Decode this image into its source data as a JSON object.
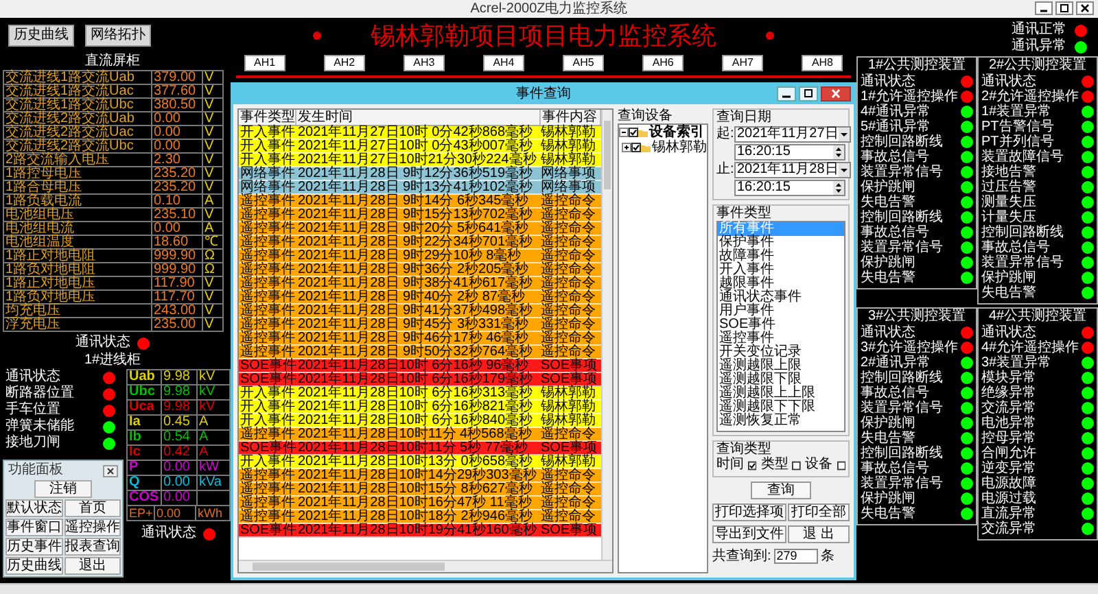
{
  "window": {
    "title": "Acrel-2000Z电力监控系统"
  },
  "toolbar_buttons": [
    "历史曲线",
    "网络拓扑"
  ],
  "page_title": "锡林郭勒项目项目电力监控系统",
  "legend": [
    {
      "label": "通讯正常",
      "color": "#ff0000"
    },
    {
      "label": "通讯异常",
      "color": "#00ff00"
    }
  ],
  "cabinet_labels": [
    "AH1",
    "AH2",
    "AH3",
    "AH4",
    "AH5",
    "AH6",
    "AH7",
    "AH8"
  ],
  "dc_panel": {
    "title": "直流屏柜",
    "rows": [
      {
        "label": "交流进线1路交流Uab",
        "value": "379.00",
        "unit": "V"
      },
      {
        "label": "交流进线1路交流Uac",
        "value": "377.60",
        "unit": "V"
      },
      {
        "label": "交流进线1路交流Ubc",
        "value": "380.50",
        "unit": "V"
      },
      {
        "label": "交流进线2路交流Uab",
        "value": "0.00",
        "unit": "V"
      },
      {
        "label": "交流进线2路交流Uac",
        "value": "0.00",
        "unit": "V"
      },
      {
        "label": "交流进线2路交流Ubc",
        "value": "0.00",
        "unit": "V"
      },
      {
        "label": "2路交流输入电压",
        "value": "2.30",
        "unit": "V"
      },
      {
        "label": "1路控母电压",
        "value": "235.20",
        "unit": "V"
      },
      {
        "label": "1路合母电压",
        "value": "235.20",
        "unit": "V"
      },
      {
        "label": "1路负载电流",
        "value": "0.10",
        "unit": "A"
      },
      {
        "label": "电池组电压",
        "value": "235.10",
        "unit": "V"
      },
      {
        "label": "电池组电流",
        "value": "0.00",
        "unit": "A"
      },
      {
        "label": "电池组温度",
        "value": "18.60",
        "unit": "℃"
      },
      {
        "label": "1路正对地电阻",
        "value": "999.90",
        "unit": "Ω"
      },
      {
        "label": "1路负对地电阻",
        "value": "999.90",
        "unit": "Ω"
      },
      {
        "label": "1路正对地电压",
        "value": "117.90",
        "unit": "V"
      },
      {
        "label": "1路负对地电压",
        "value": "117.70",
        "unit": "V"
      },
      {
        "label": "均充电压",
        "value": "243.00",
        "unit": "V"
      },
      {
        "label": "浮充电压",
        "value": "235.00",
        "unit": "V"
      }
    ],
    "comm": {
      "label": "通讯状态",
      "color": "#ff0000"
    }
  },
  "incoming_cabinet": {
    "title": "1#进线柜",
    "signals": [
      {
        "label": "通讯状态",
        "color": "#ff0000"
      },
      {
        "label": "断路器位置",
        "color": "#ff0000"
      },
      {
        "label": "手车位置",
        "color": "#ff0000"
      },
      {
        "label": "弹簧未储能",
        "color": "#00ff00"
      },
      {
        "label": "接地刀闸",
        "color": "#00ff00"
      }
    ],
    "measurements": [
      {
        "kind": "phase_a",
        "label": "Uab",
        "value": "9.98",
        "unit": "kV"
      },
      {
        "kind": "phase_b",
        "label": "Ubc",
        "value": "9.98",
        "unit": "kV"
      },
      {
        "kind": "phase_c",
        "label": "Uca",
        "value": "9.98",
        "unit": "kV"
      },
      {
        "kind": "phase_a",
        "label": "Ia",
        "value": "0.45",
        "unit": "A"
      },
      {
        "kind": "phase_b",
        "label": "Ib",
        "value": "0.54",
        "unit": "A"
      },
      {
        "kind": "phase_c",
        "label": "Ic",
        "value": "0.42",
        "unit": "A"
      },
      {
        "kind": "active",
        "label": "P",
        "value": "0.00",
        "unit": "kW"
      },
      {
        "kind": "reactive",
        "label": "Q",
        "value": "0.00",
        "unit": "kVa"
      },
      {
        "kind": "factor",
        "label": "COS",
        "value": "0.00"
      }
    ],
    "energy": {
      "label": "EP+",
      "value": "0.00",
      "unit": "kWh"
    },
    "comm": {
      "label": "通讯状态",
      "color": "#ff0000"
    }
  },
  "function_panel": {
    "title": "功能面板",
    "buttons": [
      "注销",
      "默认状态",
      "首页",
      "事件窗口",
      "遥控操作",
      "历史事件",
      "报表查询",
      "历史曲线",
      "退出"
    ]
  },
  "event_dialog": {
    "title": "事件查询",
    "table": {
      "columns": [
        "事件类型",
        "发生时间",
        "事件内容"
      ],
      "rows": [
        {
          "kind": "input",
          "type": "开入事件",
          "time": "2021年11月27日10时 0分42秒868毫秒",
          "content": "锡林郭勒"
        },
        {
          "kind": "input",
          "type": "开入事件",
          "time": "2021年11月27日10时 0分43秒007毫秒",
          "content": "锡林郭勒"
        },
        {
          "kind": "input",
          "type": "开入事件",
          "time": "2021年11月27日10时21分30秒224毫秒",
          "content": "锡林郭勒"
        },
        {
          "kind": "network",
          "type": "网络事件",
          "time": "2021年11月28日 9时12分36秒519毫秒",
          "content": "网络事项"
        },
        {
          "kind": "network",
          "type": "网络事件",
          "time": "2021年11月28日 9时13分41秒102毫秒",
          "content": "网络事项"
        },
        {
          "kind": "remote",
          "type": "遥控事件",
          "time": "2021年11月28日 9时14分 6秒345毫秒",
          "content": "遥控命令"
        },
        {
          "kind": "remote",
          "type": "遥控事件",
          "time": "2021年11月28日 9时15分13秒702毫秒",
          "content": "遥控命令"
        },
        {
          "kind": "remote",
          "type": "遥控事件",
          "time": "2021年11月28日 9时20分 5秒641毫秒",
          "content": "遥控命令"
        },
        {
          "kind": "remote",
          "type": "遥控事件",
          "time": "2021年11月28日 9时22分34秒701毫秒",
          "content": "遥控命令"
        },
        {
          "kind": "remote",
          "type": "遥控事件",
          "time": "2021年11月28日 9时29分10秒 8毫秒",
          "content": "遥控命令"
        },
        {
          "kind": "remote",
          "type": "遥控事件",
          "time": "2021年11月28日 9时36分 2秒205毫秒",
          "content": "遥控命令"
        },
        {
          "kind": "remote",
          "type": "遥控事件",
          "time": "2021年11月28日 9时38分41秒617毫秒",
          "content": "遥控命令"
        },
        {
          "kind": "remote",
          "type": "遥控事件",
          "time": "2021年11月28日 9时40分 2秒 87毫秒",
          "content": "遥控命令"
        },
        {
          "kind": "remote",
          "type": "遥控事件",
          "time": "2021年11月28日 9时41分37秒498毫秒",
          "content": "遥控命令"
        },
        {
          "kind": "remote",
          "type": "遥控事件",
          "time": "2021年11月28日 9时45分 3秒331毫秒",
          "content": "遥控命令"
        },
        {
          "kind": "remote",
          "type": "遥控事件",
          "time": "2021年11月28日 9时46分17秒 46毫秒",
          "content": "遥控命令"
        },
        {
          "kind": "remote",
          "type": "遥控事件",
          "time": "2021年11月28日 9时50分32秒764毫秒",
          "content": "遥控命令"
        },
        {
          "kind": "soe",
          "type": "SOE事件",
          "time": "2021年11月28日10时 6分16秒 96毫秒",
          "content": "SOE事项"
        },
        {
          "kind": "soe",
          "type": "SOE事件",
          "time": "2021年11月28日10时 6分16秒179毫秒",
          "content": "SOE事项"
        },
        {
          "kind": "input",
          "type": "开入事件",
          "time": "2021年11月28日10时 6分16秒313毫秒",
          "content": "锡林郭勒"
        },
        {
          "kind": "input",
          "type": "开入事件",
          "time": "2021年11月28日10时 6分16秒821毫秒",
          "content": "锡林郭勒"
        },
        {
          "kind": "input",
          "type": "开入事件",
          "time": "2021年11月28日10时 6分16秒840毫秒",
          "content": "锡林郭勒"
        },
        {
          "kind": "remote",
          "type": "遥控事件",
          "time": "2021年11月28日10时11分 4秒568毫秒",
          "content": "遥控命令"
        },
        {
          "kind": "soe",
          "type": "SOE事件",
          "time": "2021年11月28日10时11分 5秒 77毫秒",
          "content": "SOE事项"
        },
        {
          "kind": "input",
          "type": "开入事件",
          "time": "2021年11月28日10时13分 0秒658毫秒",
          "content": "锡林郭勒"
        },
        {
          "kind": "remote",
          "type": "遥控事件",
          "time": "2021年11月28日10时14分29秒303毫秒",
          "content": "遥控命令"
        },
        {
          "kind": "remote",
          "type": "遥控事件",
          "time": "2021年11月28日10时15分 8秒627毫秒",
          "content": "遥控命令"
        },
        {
          "kind": "remote",
          "type": "遥控事件",
          "time": "2021年11月28日10时16分47秒 11毫秒",
          "content": "遥控命令"
        },
        {
          "kind": "remote",
          "type": "遥控事件",
          "time": "2021年11月28日10时18分 2秒946毫秒",
          "content": "遥控命令"
        },
        {
          "kind": "soe",
          "type": "SOE事件",
          "time": "2021年11月28日10时19分41秒160毫秒",
          "content": "SOE事项"
        }
      ]
    },
    "device_tree": {
      "title": "查询设备",
      "items": [
        {
          "label": "设备索引",
          "checked": true,
          "expanded": true,
          "children": [
            {
              "label": "锡林郭勒",
              "checked": true,
              "expanded": false
            }
          ]
        }
      ]
    },
    "date_range": {
      "title": "查询日期",
      "start_label": "起:",
      "start_date": "2021年11月27日",
      "start_time": "16:20:15",
      "end_label": "止:",
      "end_date": "2021年11月28日",
      "end_time": "16:20:15"
    },
    "event_types": {
      "title": "事件类型",
      "items": [
        {
          "label": "所有事件",
          "selected": true
        },
        {
          "label": "保护事件",
          "selected": false
        },
        {
          "label": "故障事件",
          "selected": false
        },
        {
          "label": "开入事件",
          "selected": false
        },
        {
          "label": "越限事件",
          "selected": false
        },
        {
          "label": "通讯状态事件",
          "selected": false
        },
        {
          "label": "用户事件",
          "selected": false
        },
        {
          "label": "SOE事件",
          "selected": false
        },
        {
          "label": "遥控事件",
          "selected": false
        },
        {
          "label": "开关变位记录",
          "selected": false
        },
        {
          "label": "遥测越限上限",
          "selected": false
        },
        {
          "label": "遥测越限下限",
          "selected": false
        },
        {
          "label": "遥测越限上上限",
          "selected": false
        },
        {
          "label": "遥测越限下下限",
          "selected": false
        },
        {
          "label": "遥测恢复正常",
          "selected": false
        }
      ]
    },
    "query_type": {
      "title": "查询类型",
      "options": [
        {
          "label": "时间",
          "checked": true
        },
        {
          "label": "类型",
          "checked": false
        },
        {
          "label": "设备",
          "checked": false
        }
      ]
    },
    "buttons": [
      "查询",
      "打印选择项",
      "打印全部",
      "导出到文件",
      "退 出"
    ],
    "count_label": "共查询到:",
    "count": "279",
    "count_unit": "条"
  },
  "monitor_panels": [
    {
      "title": "1#公共测控装置",
      "signals": [
        {
          "label": "通讯状态",
          "color": "#ff0000"
        },
        {
          "label": "1#允许遥控操作",
          "color": "#ff0000"
        },
        {
          "label": "4#通讯异常",
          "color": "#00ff00"
        },
        {
          "label": "5#通讯异常",
          "color": "#00ff00"
        },
        {
          "label": "控制回路断线",
          "color": "#00ff00"
        },
        {
          "label": "事故总信号",
          "color": "#00ff00"
        },
        {
          "label": "装置异常信号",
          "color": "#00ff00"
        },
        {
          "label": "保护跳闸",
          "color": "#00ff00"
        },
        {
          "label": "失电告警",
          "color": "#00ff00"
        },
        {
          "label": "控制回路断线",
          "color": "#00ff00"
        },
        {
          "label": "事故总信号",
          "color": "#00ff00"
        },
        {
          "label": "装置异常信号",
          "color": "#00ff00"
        },
        {
          "label": "保护跳闸",
          "color": "#00ff00"
        },
        {
          "label": "失电告警",
          "color": "#00ff00"
        }
      ]
    },
    {
      "title": "2#公共测控装置",
      "signals": [
        {
          "label": "通讯状态",
          "color": "#ff0000"
        },
        {
          "label": "2#允许遥控操作",
          "color": "#ff0000"
        },
        {
          "label": "1#装置异常",
          "color": "#00ff00"
        },
        {
          "label": "PT告警信号",
          "color": "#00ff00"
        },
        {
          "label": "PT并列信号",
          "color": "#00ff00"
        },
        {
          "label": "装置故障信号",
          "color": "#00ff00"
        },
        {
          "label": "接地告警",
          "color": "#00ff00"
        },
        {
          "label": "过压告警",
          "color": "#00ff00"
        },
        {
          "label": "测量失压",
          "color": "#00ff00"
        },
        {
          "label": "计量失压",
          "color": "#00ff00"
        },
        {
          "label": "控制回路断线",
          "color": "#00ff00"
        },
        {
          "label": "事故总信号",
          "color": "#00ff00"
        },
        {
          "label": "装置异常信号",
          "color": "#00ff00"
        },
        {
          "label": "保护跳闸",
          "color": "#00ff00"
        },
        {
          "label": "失电告警",
          "color": "#00ff00"
        }
      ]
    },
    {
      "title": "3#公共测控装置",
      "signals": [
        {
          "label": "通讯状态",
          "color": "#ff0000"
        },
        {
          "label": "3#允许遥控操作",
          "color": "#ff0000"
        },
        {
          "label": "2#通讯异常",
          "color": "#00ff00"
        },
        {
          "label": "控制回路断线",
          "color": "#00ff00"
        },
        {
          "label": "事故总信号",
          "color": "#00ff00"
        },
        {
          "label": "装置异常信号",
          "color": "#00ff00"
        },
        {
          "label": "保护跳闸",
          "color": "#00ff00"
        },
        {
          "label": "失电告警",
          "color": "#00ff00"
        },
        {
          "label": "控制回路断线",
          "color": "#00ff00"
        },
        {
          "label": "事故总信号",
          "color": "#00ff00"
        },
        {
          "label": "装置异常信号",
          "color": "#00ff00"
        },
        {
          "label": "保护跳闸",
          "color": "#00ff00"
        },
        {
          "label": "失电告警",
          "color": "#00ff00"
        }
      ]
    },
    {
      "title": "4#公共测控装置",
      "signals": [
        {
          "label": "通讯状态",
          "color": "#ff0000"
        },
        {
          "label": "4#允许遥控操作",
          "color": "#ff0000"
        },
        {
          "label": "3#装置异常",
          "color": "#00ff00"
        },
        {
          "label": "模块异常",
          "color": "#00ff00"
        },
        {
          "label": "绝缘异常",
          "color": "#00ff00"
        },
        {
          "label": "交流异常",
          "color": "#00ff00"
        },
        {
          "label": "电池异常",
          "color": "#00ff00"
        },
        {
          "label": "控母异常",
          "color": "#00ff00"
        },
        {
          "label": "合闸允许",
          "color": "#00ff00"
        },
        {
          "label": "逆变异常",
          "color": "#00ff00"
        },
        {
          "label": "电源故障",
          "color": "#00ff00"
        },
        {
          "label": "电源过载",
          "color": "#00ff00"
        },
        {
          "label": "直流异常",
          "color": "#00ff00"
        },
        {
          "label": "交流异常",
          "color": "#00ff00"
        }
      ]
    }
  ]
}
